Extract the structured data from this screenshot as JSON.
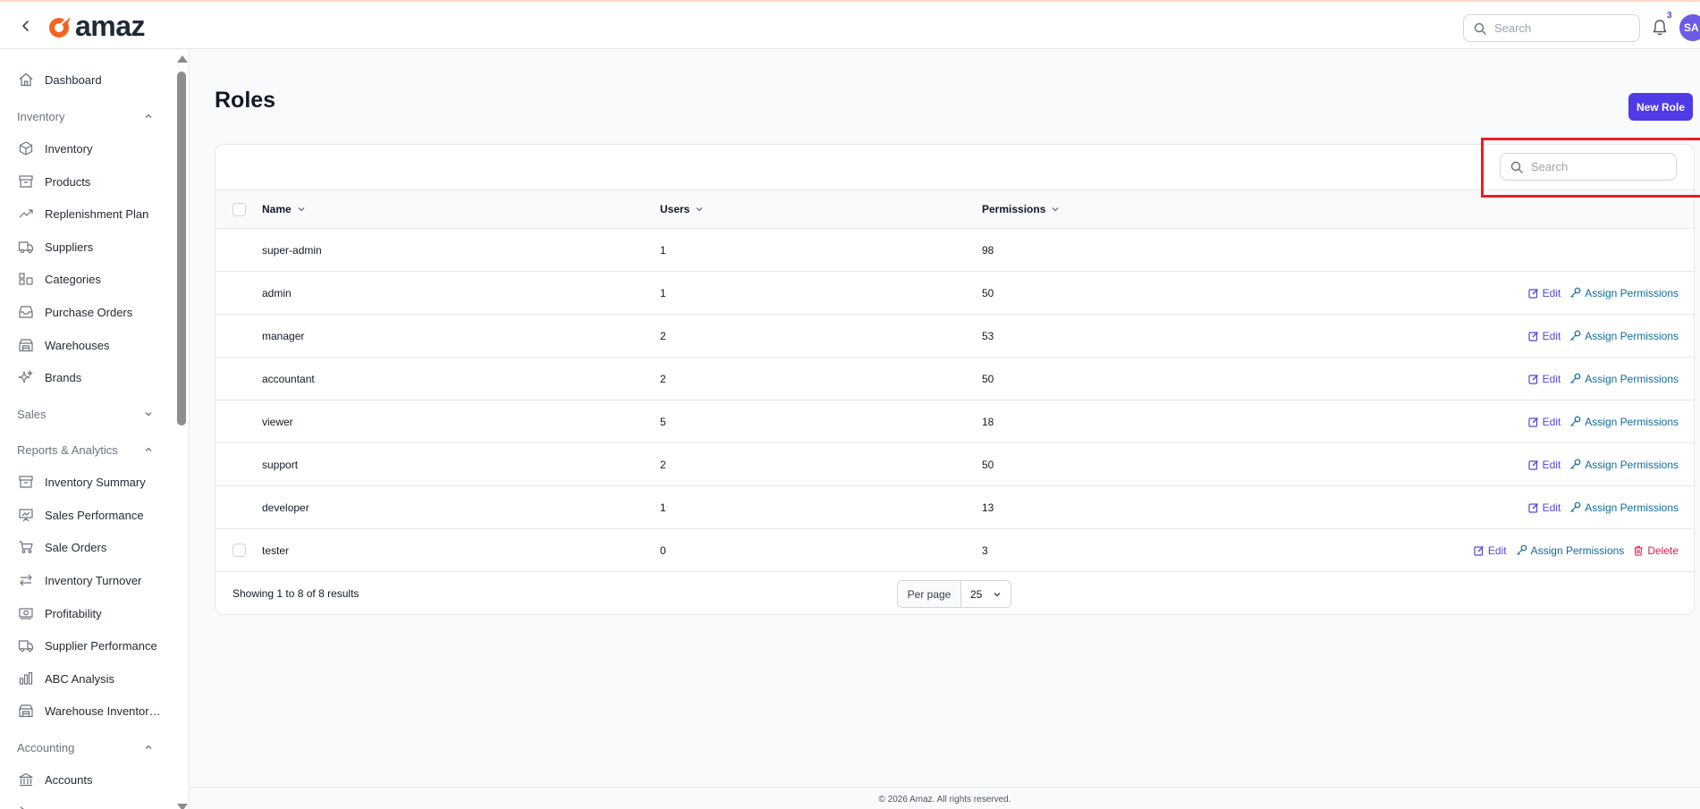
{
  "app": {
    "logo_text": "amaz",
    "brand_color": "#f26322",
    "accent_color": "#4f3ae8"
  },
  "header": {
    "search_placeholder": "Search",
    "notifications_count": "3",
    "avatar_initials": "SA"
  },
  "sidebar": {
    "dashboard": "Dashboard",
    "inventory_group": "Inventory",
    "inventory_items": [
      {
        "label": "Inventory",
        "icon": "cube-icon"
      },
      {
        "label": "Products",
        "icon": "archive-icon"
      },
      {
        "label": "Replenishment Plan",
        "icon": "trending-up-icon"
      },
      {
        "label": "Suppliers",
        "icon": "truck-icon"
      },
      {
        "label": "Categories",
        "icon": "categories-icon"
      },
      {
        "label": "Purchase Orders",
        "icon": "inbox-icon"
      },
      {
        "label": "Warehouses",
        "icon": "warehouse-icon"
      },
      {
        "label": "Brands",
        "icon": "sparkles-icon"
      }
    ],
    "sales_group": "Sales",
    "reports_group": "Reports & Analytics",
    "reports_items": [
      {
        "label": "Inventory Summary",
        "icon": "archive-icon"
      },
      {
        "label": "Sales Performance",
        "icon": "presentation-chart-icon"
      },
      {
        "label": "Sale Orders",
        "icon": "cart-icon"
      },
      {
        "label": "Inventory Turnover",
        "icon": "arrows-right-left-icon"
      },
      {
        "label": "Profitability",
        "icon": "banknotes-icon"
      },
      {
        "label": "Supplier Performance",
        "icon": "truck-icon"
      },
      {
        "label": "ABC Analysis",
        "icon": "bar-chart-icon"
      },
      {
        "label": "Warehouse Inventor…",
        "icon": "warehouse-icon"
      }
    ],
    "accounting_group": "Accounting",
    "accounting_items": [
      {
        "label": "Accounts",
        "icon": "bank-icon"
      }
    ]
  },
  "main": {
    "title": "Roles",
    "new_role_label": "New Role",
    "search_placeholder": "Search",
    "columns": {
      "name": "Name",
      "users": "Users",
      "permissions": "Permissions"
    },
    "rows": [
      {
        "name": "super-admin",
        "users": "1",
        "permissions": "98",
        "edit": "",
        "assign": "",
        "delete": ""
      },
      {
        "name": "admin",
        "users": "1",
        "permissions": "50",
        "edit": "Edit",
        "assign": "Assign Permissions",
        "delete": ""
      },
      {
        "name": "manager",
        "users": "2",
        "permissions": "53",
        "edit": "Edit",
        "assign": "Assign Permissions",
        "delete": ""
      },
      {
        "name": "accountant",
        "users": "2",
        "permissions": "50",
        "edit": "Edit",
        "assign": "Assign Permissions",
        "delete": ""
      },
      {
        "name": "viewer",
        "users": "5",
        "permissions": "18",
        "edit": "Edit",
        "assign": "Assign Permissions",
        "delete": ""
      },
      {
        "name": "support",
        "users": "2",
        "permissions": "50",
        "edit": "Edit",
        "assign": "Assign Permissions",
        "delete": ""
      },
      {
        "name": "developer",
        "users": "1",
        "permissions": "13",
        "edit": "Edit",
        "assign": "Assign Permissions",
        "delete": ""
      },
      {
        "name": "tester",
        "users": "0",
        "permissions": "3",
        "edit": "Edit",
        "assign": "Assign Permissions",
        "delete": "Delete"
      }
    ],
    "results_text": "Showing 1 to 8 of 8 results",
    "per_page_label": "Per page",
    "per_page_value": "25"
  },
  "footer": {
    "copyright": "© 2026 Amaz. All rights reserved."
  }
}
